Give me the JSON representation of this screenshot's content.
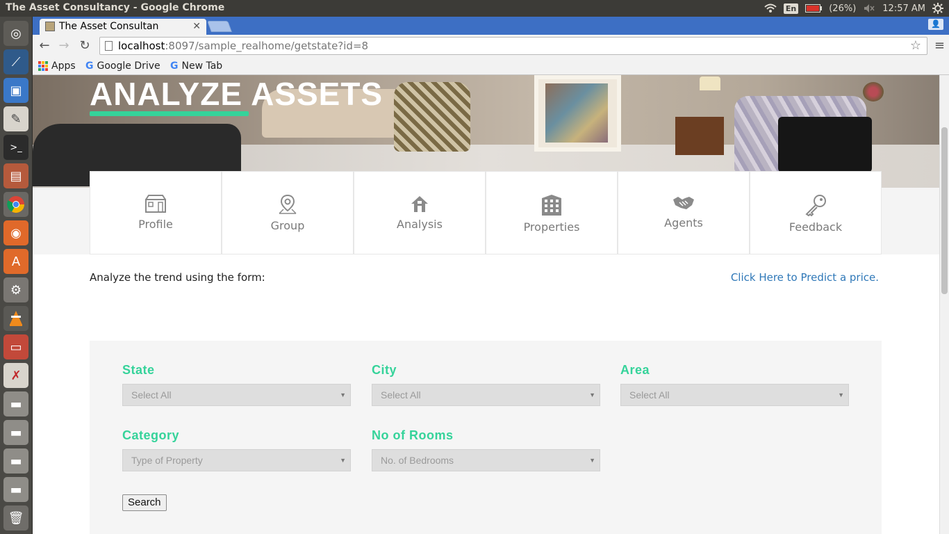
{
  "os_panel": {
    "window_title": "The Asset Consultancy - Google Chrome",
    "keyboard_layout": "En",
    "battery": "(26%)",
    "clock": "12:57 AM"
  },
  "launcher": {
    "items": [
      "dash-icon",
      "mysql-workbench-icon",
      "virtualbox-icon",
      "text-editor-icon",
      "terminal-icon",
      "files-icon",
      "chrome-icon",
      "firefox-icon",
      "software-center-icon",
      "system-settings-icon",
      "vlc-icon",
      "screenshot-icon",
      "xampp-icon",
      "drive-icon",
      "drive-icon",
      "drive-icon",
      "drive-icon",
      "trash-icon"
    ]
  },
  "browser": {
    "tab_title": "The Asset Consultan",
    "url_host": "localhost",
    "url_rest": ":8097/sample_realhome/getstate?id=8",
    "bookmarks": [
      "Apps",
      "Google Drive",
      "New Tab"
    ]
  },
  "page": {
    "hero_title": "ANALYZE ASSETS",
    "nav": [
      "Profile",
      "Group",
      "Analysis",
      "Properties",
      "Agents",
      "Feedback"
    ],
    "intro": "Analyze the trend using the form:",
    "predict_link": "Click Here to Predict a price.",
    "form": {
      "state": {
        "label": "State",
        "value": "Select All"
      },
      "city": {
        "label": "City",
        "value": "Select All"
      },
      "area": {
        "label": "Area",
        "value": "Select All"
      },
      "category": {
        "label": "Category",
        "value": "Type of Property"
      },
      "rooms": {
        "label": "No of Rooms",
        "value": "No. of Bedrooms"
      },
      "search": "Search"
    },
    "colors": {
      "accent": "#35d39a",
      "link": "#2f78b8"
    }
  }
}
